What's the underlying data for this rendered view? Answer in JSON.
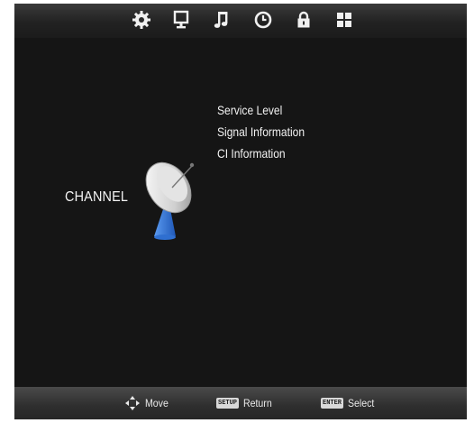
{
  "top_menu": {
    "icons": [
      "settings-gear-icon",
      "monitor-icon",
      "music-note-icon",
      "clock-icon",
      "lock-icon",
      "grid-icon"
    ]
  },
  "channel": {
    "label": "CHANNEL",
    "icon": "satellite-dish-icon",
    "items": [
      "Service Level",
      "Signal Information",
      "CI Information"
    ]
  },
  "footer": {
    "move_label": "Move",
    "return_key": "SETUP",
    "return_label": "Return",
    "select_key": "ENTER",
    "select_label": "Select"
  },
  "colors": {
    "background": "#161616",
    "bar": "#2a2a2a",
    "text": "#f2f2f2",
    "dish_stand": "#2f6fd0"
  }
}
